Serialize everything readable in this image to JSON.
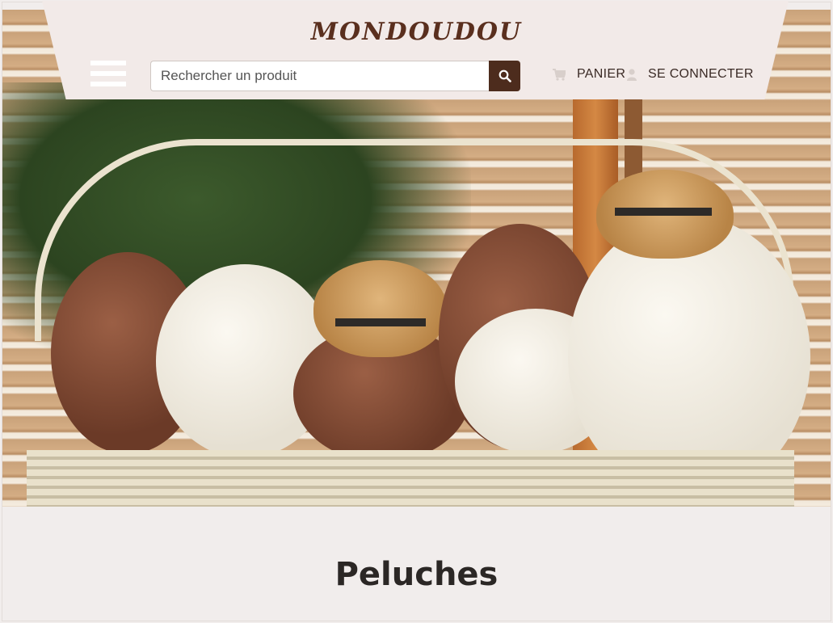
{
  "header": {
    "logo_text": "MONDOUDOU",
    "search": {
      "placeholder": "Rechercher un produit"
    },
    "cart_label": "PANIER",
    "login_label": "SE CONNECTER"
  },
  "icons": {
    "menu": "hamburger-icon",
    "search": "search-icon",
    "cart": "cart-icon",
    "user": "user-icon"
  },
  "colors": {
    "accent": "#4d2c1d",
    "header_bg": "#f2eae8",
    "page_bg": "#f1edec"
  },
  "main": {
    "page_title": "Peluches"
  }
}
